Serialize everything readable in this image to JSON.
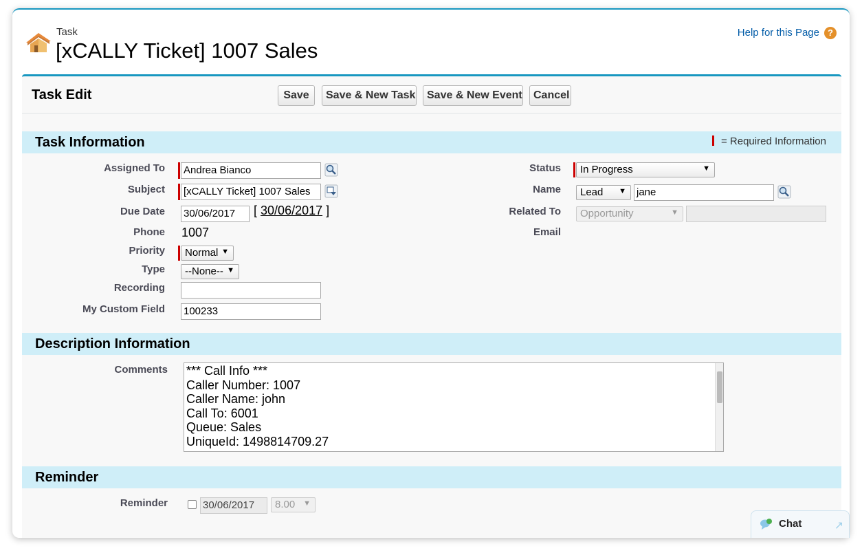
{
  "header": {
    "type_label": "Task",
    "title": "[xCALLY Ticket] 1007 Sales",
    "help_link": "Help for this Page",
    "help_icon_glyph": "?"
  },
  "toolbar": {
    "title": "Task Edit",
    "save": "Save",
    "save_new_task": "Save & New Task",
    "save_new_event": "Save & New Event",
    "cancel": "Cancel"
  },
  "task_info": {
    "section_title": "Task Information",
    "required_legend": "= Required Information",
    "assigned_to": {
      "label": "Assigned To",
      "value": "Andrea Bianco"
    },
    "subject": {
      "label": "Subject",
      "value": "[xCALLY Ticket] 1007 Sales"
    },
    "due_date": {
      "label": "Due Date",
      "value": "30/06/2017",
      "today_link": "30/06/2017",
      "bracket_open": "[",
      "bracket_close": "]"
    },
    "phone": {
      "label": "Phone",
      "value": "1007"
    },
    "priority": {
      "label": "Priority",
      "value": "Normal"
    },
    "type": {
      "label": "Type",
      "value": "--None--"
    },
    "recording": {
      "label": "Recording",
      "value": ""
    },
    "custom_field": {
      "label": "My Custom Field",
      "value": "100233"
    },
    "status": {
      "label": "Status",
      "value": "In Progress"
    },
    "name": {
      "label": "Name",
      "type_value": "Lead",
      "value": "jane"
    },
    "related_to": {
      "label": "Related To",
      "type_value": "Opportunity",
      "value": ""
    },
    "email": {
      "label": "Email",
      "value": ""
    }
  },
  "description": {
    "section_title": "Description Information",
    "comments_label": "Comments",
    "comments_lines": [
      "*** Call Info ***",
      "Caller Number: 1007",
      "Caller Name: john",
      "Call To: 6001",
      "Queue: Sales",
      "UniqueId: 1498814709.27"
    ]
  },
  "reminder": {
    "section_title": "Reminder",
    "label": "Reminder",
    "date": "30/06/2017",
    "time": "8.00",
    "checked": false
  },
  "chat": {
    "label": "Chat"
  },
  "colors": {
    "accent": "#1797c0",
    "section_bg": "#cfeef8",
    "required": "#cc0000",
    "link": "#015ba7"
  }
}
